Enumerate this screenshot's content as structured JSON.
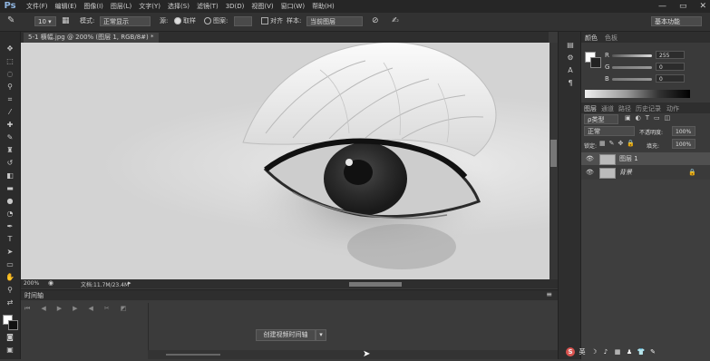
{
  "app": {
    "logo": "Ps"
  },
  "menu": [
    "文件(F)",
    "编辑(E)",
    "图像(I)",
    "图层(L)",
    "文字(Y)",
    "选择(S)",
    "滤镜(T)",
    "3D(D)",
    "视图(V)",
    "窗口(W)",
    "帮助(H)"
  ],
  "window_controls": {
    "minimize": "—",
    "restore": "▭",
    "close": "✕"
  },
  "options_bar": {
    "brush_size": "10",
    "mode_label": "模式:",
    "mode_value": "正常显示",
    "source_label": "源:",
    "source_sampled": "取样",
    "source_pattern": "图案:",
    "aligned_label": "对齐",
    "sample_label": "样本:",
    "sample_value": "当前图层",
    "workspace": "基本功能"
  },
  "document": {
    "tab_title": "5-1 横幅.jpg @ 200% (图层 1, RGB/8#) *",
    "zoom": "200%",
    "doc_info": "文档:11.7M/23.4M"
  },
  "timeline": {
    "panel_title": "时间轴",
    "create_button": "创建视频时间轴"
  },
  "color_panel": {
    "tab_color": "颜色",
    "tab_swatches": "色板",
    "r_label": "R",
    "r_value": "255",
    "g_label": "G",
    "g_value": "0",
    "b_label": "B",
    "b_value": "0"
  },
  "layers_panel": {
    "tabs": [
      "图层",
      "通道",
      "路径",
      "历史记录",
      "动作"
    ],
    "filter_kind": "ρ类型",
    "blend_mode": "正常",
    "opacity_label": "不透明度:",
    "opacity_value": "100%",
    "lock_label": "锁定:",
    "fill_label": "填充:",
    "fill_value": "100%",
    "layers": [
      {
        "name": "图层 1"
      },
      {
        "name": "背景"
      }
    ]
  },
  "tray": [
    "S",
    "英",
    "☽",
    "♪",
    "▦",
    "♟",
    "👕",
    "✎"
  ]
}
